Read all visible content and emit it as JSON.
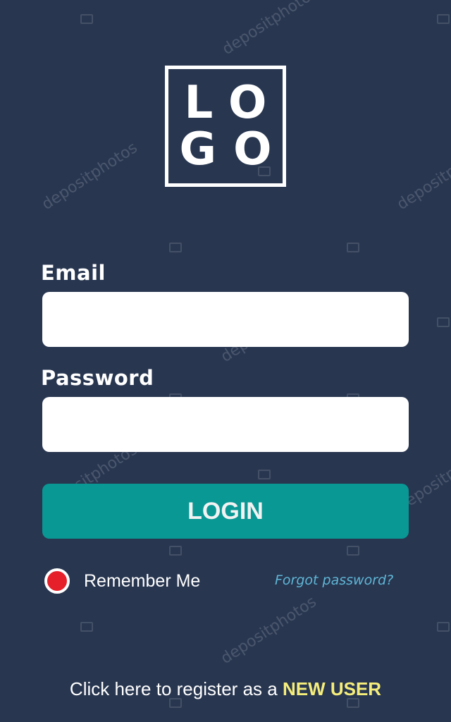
{
  "logo": {
    "line1": "LO",
    "line2": "GO"
  },
  "form": {
    "email_label": "Email",
    "email_value": "",
    "password_label": "Password",
    "password_value": "",
    "login_label": "LOGIN"
  },
  "remember": {
    "label": "Remember Me",
    "checked": true
  },
  "forgot": {
    "label": "Forgot password?"
  },
  "register": {
    "prefix": "Click here to register as a",
    "link": "NEW USER"
  },
  "watermark": {
    "text": "depositphotos"
  },
  "colors": {
    "background": "#283650",
    "button": "#099894",
    "radio": "#e5202a",
    "forgot_link": "#5fb6d6",
    "new_user": "#f6ee7a"
  }
}
